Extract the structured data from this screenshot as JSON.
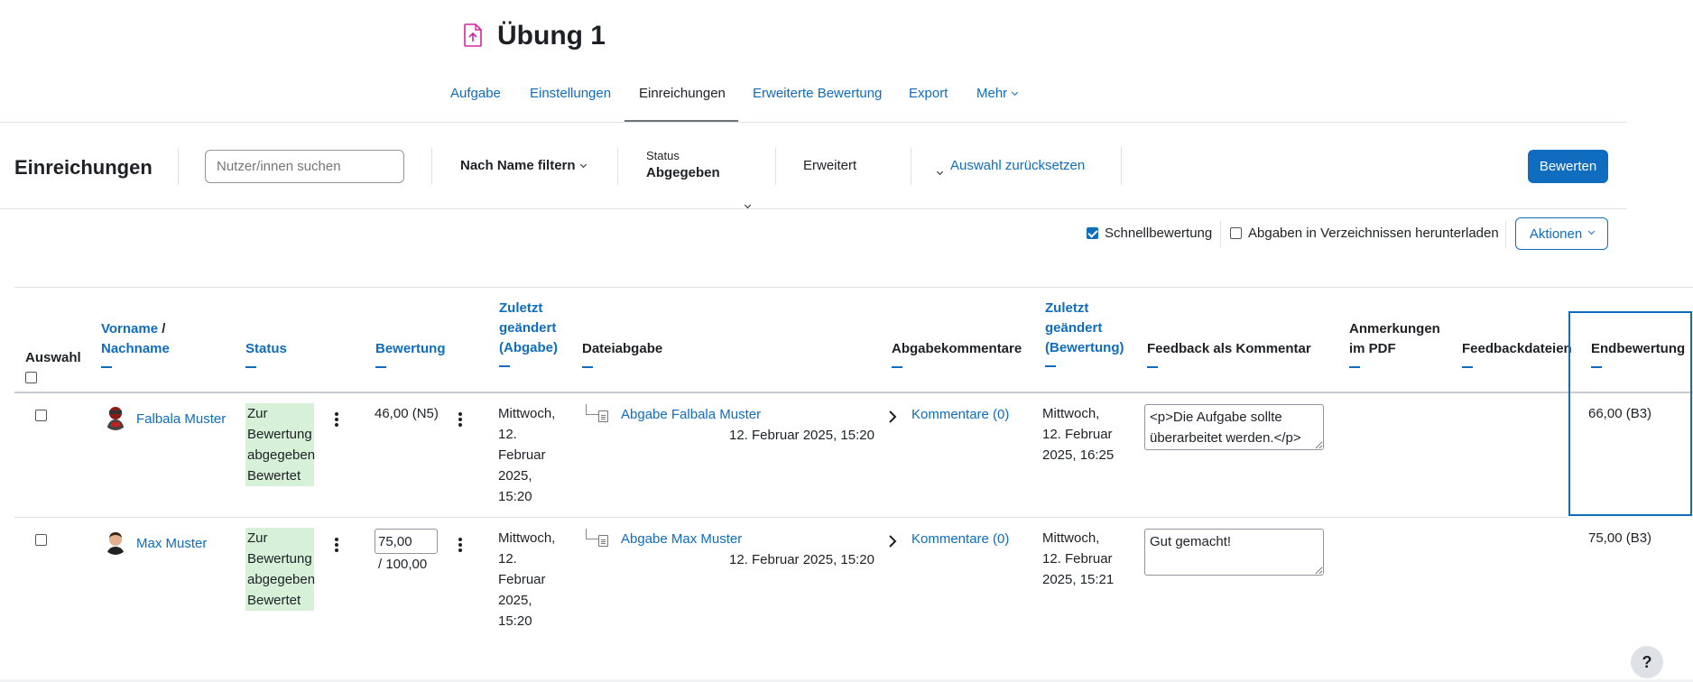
{
  "page": {
    "title": "Übung 1",
    "icon": "assignment-upload-icon",
    "accent_icon_color": "#d6249f"
  },
  "nav": {
    "tabs": [
      {
        "label": "Aufgabe",
        "active": false
      },
      {
        "label": "Einstellungen",
        "active": false
      },
      {
        "label": "Einreichungen",
        "active": true
      },
      {
        "label": "Erweiterte Bewertung",
        "active": false
      },
      {
        "label": "Export",
        "active": false
      },
      {
        "label": "Mehr",
        "active": false
      }
    ]
  },
  "toolbar": {
    "heading": "Einreichungen",
    "search_placeholder": "Nutzer/innen suchen",
    "name_filter": "Nach Name filtern",
    "status_label": "Status",
    "status_value": "Abgegeben",
    "advanced": "Erweitert",
    "reset": "Auswahl zurücksetzen",
    "grade_button": "Bewerten"
  },
  "options": {
    "quick_grading": "Schnellbewertung",
    "quick_grading_checked": true,
    "download_folders": "Abgaben in Verzeichnissen herunterladen",
    "download_folders_checked": false,
    "actions": "Aktionen"
  },
  "table": {
    "headers": {
      "select": "Auswahl",
      "name": "Vorname",
      "name_sep": "/",
      "surname": "Nachname",
      "status": "Status",
      "grade": "Bewertung",
      "modified_submission_1": "Zuletzt",
      "modified_submission_2": "geändert",
      "modified_submission_3": "(Abgabe)",
      "file_submission": "Dateiabgabe",
      "submission_comments": "Abgabekommentare",
      "modified_grade_1": "Zuletzt",
      "modified_grade_2": "geändert",
      "modified_grade_3": "(Bewertung)",
      "feedback_comment": "Feedback als Kommentar",
      "annotations_1": "Anmerkungen",
      "annotations_2": "im PDF",
      "feedback_files": "Feedbackdateien",
      "final_grade": "Endbewertung"
    },
    "rows": [
      {
        "name": "Falbala Muster",
        "status_1": "Zur",
        "status_2": "Bewertung",
        "status_3": "abgegeben",
        "status_4": "Bewertet",
        "grade": "46,00 (N5)",
        "modified_1": "Mittwoch,",
        "modified_2": "12.",
        "modified_3": "Februar",
        "modified_4": "2025,",
        "modified_5": "15:20",
        "file_link": "Abgabe Falbala Muster",
        "file_date": "12. Februar 2025, 15:20",
        "comments": "Kommentare (0)",
        "graded_1": "Mittwoch,",
        "graded_2": "12. Februar",
        "graded_3": "2025, 16:25",
        "feedback": "<p>Die Aufgabe sollte überarbeitet werden.</p>",
        "final_grade": "66,00 (B3)"
      },
      {
        "name": "Max Muster",
        "status_1": "Zur",
        "status_2": "Bewertung",
        "status_3": "abgegeben",
        "status_4": "Bewertet",
        "grade_input": "75,00",
        "grade_max": "/ 100,00",
        "modified_1": "Mittwoch,",
        "modified_2": "12.",
        "modified_3": "Februar",
        "modified_4": "2025,",
        "modified_5": "15:20",
        "file_link": "Abgabe Max Muster",
        "file_date": "12. Februar 2025, 15:20",
        "comments": "Kommentare (0)",
        "graded_1": "Mittwoch,",
        "graded_2": "12. Februar",
        "graded_3": "2025, 15:21",
        "feedback": "Gut gemacht!",
        "final_grade": "75,00 (B3)"
      }
    ]
  },
  "help": "?",
  "colors": {
    "link": "#0f6cbf",
    "status_bg": "#d7f1d9",
    "highlight_border": "#0f6cbf"
  }
}
